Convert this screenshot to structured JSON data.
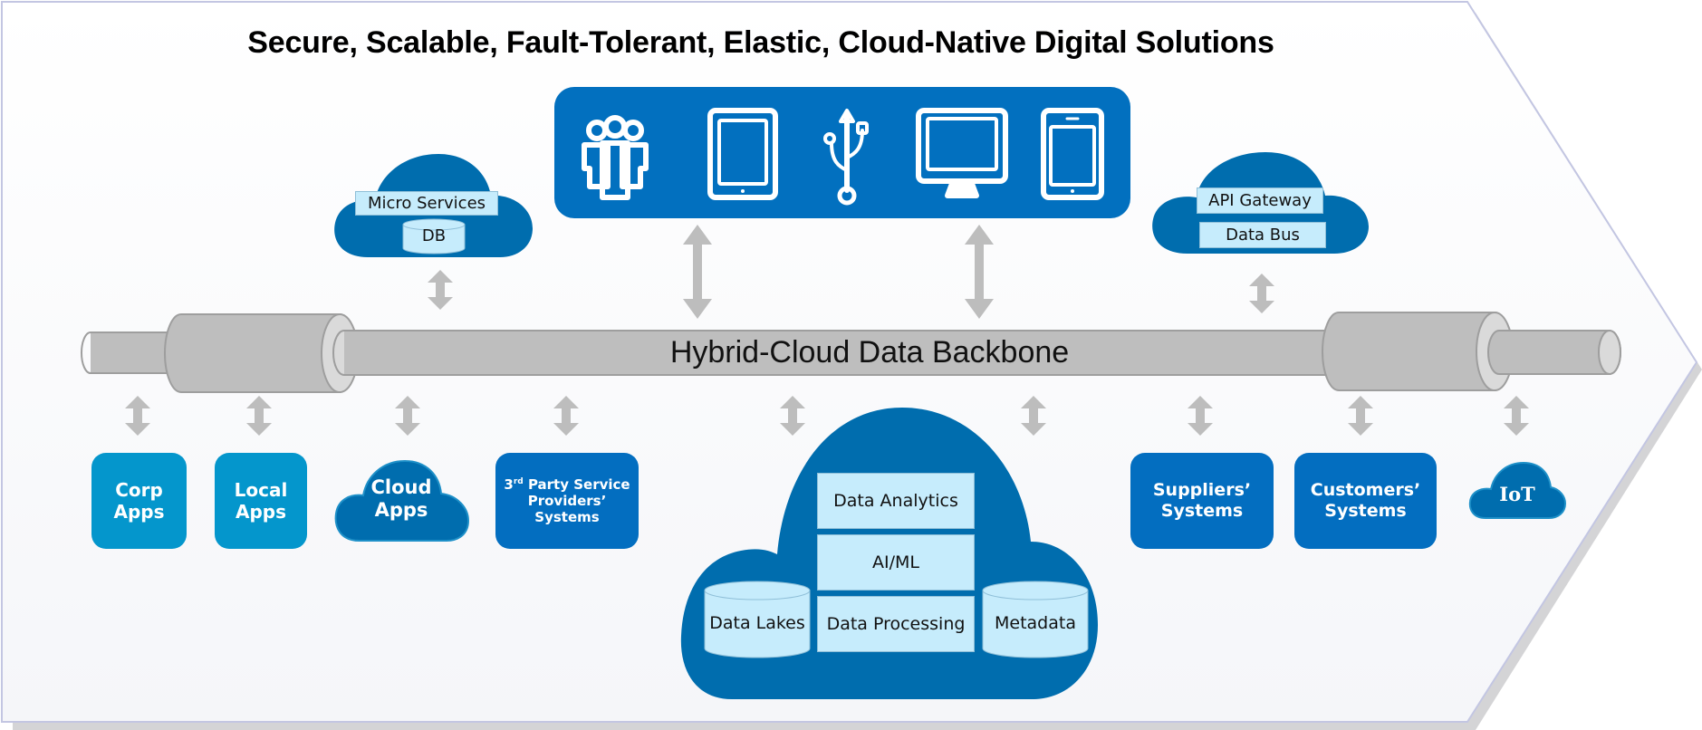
{
  "title": "Secure, Scalable, Fault-Tolerant, Elastic, Cloud-Native Digital Solutions",
  "colors": {
    "chevron_fill": "#f7f8fb",
    "chevron_border": "#c3c6e2",
    "chevron_shadow": "#d4d4d6",
    "primary_blue": "#0270bf",
    "cloud_blue": "#006dae",
    "light_tile_blue": "#0496cc",
    "label_box_fill": "#c6ecfc",
    "pipe_gray": "#bebebe",
    "arrow_gray": "#bdbdbd"
  },
  "devices": {
    "icons": [
      "users-group-icon",
      "tablet-icon",
      "usb-icon",
      "desktop-monitor-icon",
      "smartphone-icon"
    ]
  },
  "top_clouds": {
    "left": {
      "service": "Micro Services",
      "db": "DB"
    },
    "right": {
      "gateway": "API Gateway",
      "bus": "Data Bus"
    }
  },
  "backbone": {
    "label": "Hybrid-Cloud Data Backbone"
  },
  "bottom_systems": {
    "corp_apps": {
      "line1": "Corp",
      "line2": "Apps"
    },
    "local_apps": {
      "line1": "Local",
      "line2": "Apps"
    },
    "cloud_apps": {
      "line1": "Cloud",
      "line2": "Apps"
    },
    "third_party": {
      "ordinal": "3",
      "ordinal_suffix": "rd",
      "line1_rest": " Party Service",
      "line2": "Providers’",
      "line3": "Systems"
    },
    "suppliers": {
      "line1": "Suppliers’",
      "line2": "Systems"
    },
    "customers": {
      "line1": "Customers’",
      "line2": "Systems"
    },
    "iot": {
      "label": "IoT"
    }
  },
  "data_cloud": {
    "stack": [
      "Data Analytics",
      "AI/ML",
      "Data Processing"
    ],
    "left_store": "Data Lakes",
    "right_store": "Metadata"
  }
}
